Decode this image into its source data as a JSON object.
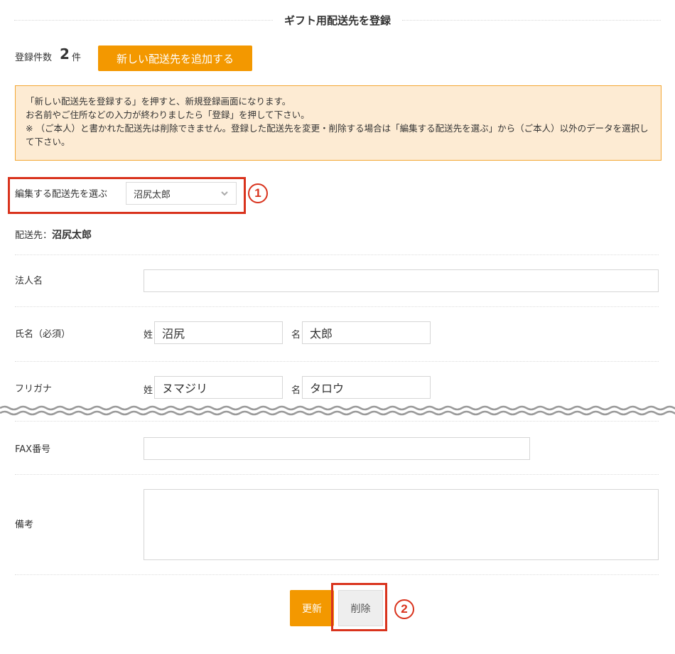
{
  "page": {
    "title": "ギフト用配送先を登録"
  },
  "count": {
    "label": "登録件数",
    "value": "2",
    "unit": "件",
    "add_button": "新しい配送先を追加する"
  },
  "notice": {
    "lines": [
      "「新しい配送先を登録する」を押すと、新規登録画面になります。",
      "お名前やご住所などの入力が終わりましたら「登録」を押して下さい。",
      "※ （ご本人）と書かれた配送先は削除できません。登録した配送先を変更・削除する場合は「編集する配送先を選ぶ」から（ご本人）以外のデータを選択して下さい。"
    ]
  },
  "selector": {
    "label": "編集する配送先を選ぶ",
    "selected": "沼尻太郎",
    "badge": "1"
  },
  "destination": {
    "prefix": "配送先：",
    "name": "沼尻太郎"
  },
  "form": {
    "company_label": "法人名",
    "company_value": "",
    "name_label": "氏名（必須）",
    "last_label": "姓",
    "first_label": "名",
    "last_name": "沼尻",
    "first_name": "太郎",
    "kana_label": "フリガナ",
    "last_kana": "ヌマジリ",
    "first_kana": "タロウ",
    "fax_label": "FAX番号",
    "fax_value": "",
    "memo_label": "備考",
    "memo_value": ""
  },
  "actions": {
    "update": "更新",
    "delete": "削除",
    "badge": "2"
  },
  "colors": {
    "accent": "#f39800",
    "notice_bg": "#fdebd3",
    "notice_border": "#f3a734",
    "annotation": "#d9331d"
  }
}
